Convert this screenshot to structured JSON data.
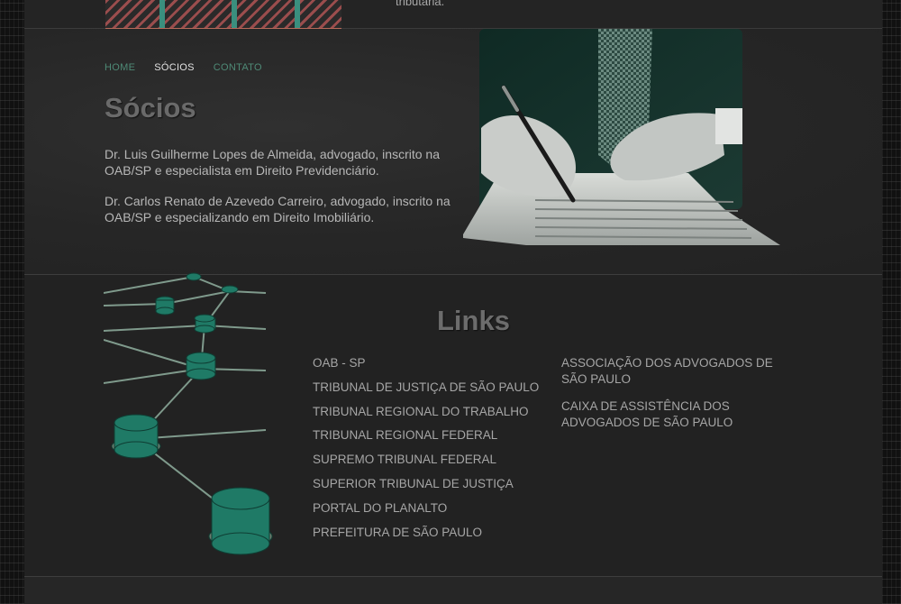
{
  "top": {
    "partial_text": "tributária."
  },
  "nav": {
    "items": [
      {
        "label": "HOME",
        "active": false
      },
      {
        "label": "SÓCIOS",
        "active": true
      },
      {
        "label": "CONTATO",
        "active": false
      }
    ]
  },
  "socios": {
    "title": "Sócios",
    "paragraphs": [
      "Dr. Luis Guilherme Lopes de Almeida, advogado, inscrito na OAB/SP e especialista em Direito Previdenciário.",
      "Dr. Carlos Renato de Azevedo Carreiro, advogado, inscrito na OAB/SP e especializando em Direito Imobiliário."
    ]
  },
  "links": {
    "title": "Links",
    "column1": [
      "OAB - SP",
      "TRIBUNAL DE JUSTIÇA DE SÃO PAULO",
      "TRIBUNAL REGIONAL DO TRABALHO",
      "TRIBUNAL REGIONAL FEDERAL",
      "SUPREMO TRIBUNAL FEDERAL",
      "SUPERIOR TRIBUNAL DE JUSTIÇA",
      "PORTAL DO PLANALTO",
      "PREFEITURA DE SÃO PAULO"
    ],
    "column2": [
      "ASSOCIAÇÃO DOS ADVOGADOS DE SÃO PAULO",
      "CAIXA DE ASSISTÊNCIA DOS ADVOGADOS DE SÃO PAULO"
    ]
  },
  "colors": {
    "page_bg": "#232323",
    "nav_inactive": "#4e8a76",
    "nav_active": "#e2e2e2",
    "heading": "#6a6a6a",
    "body_text": "#b7b7b7",
    "accent_teal": "#1f7a66"
  }
}
